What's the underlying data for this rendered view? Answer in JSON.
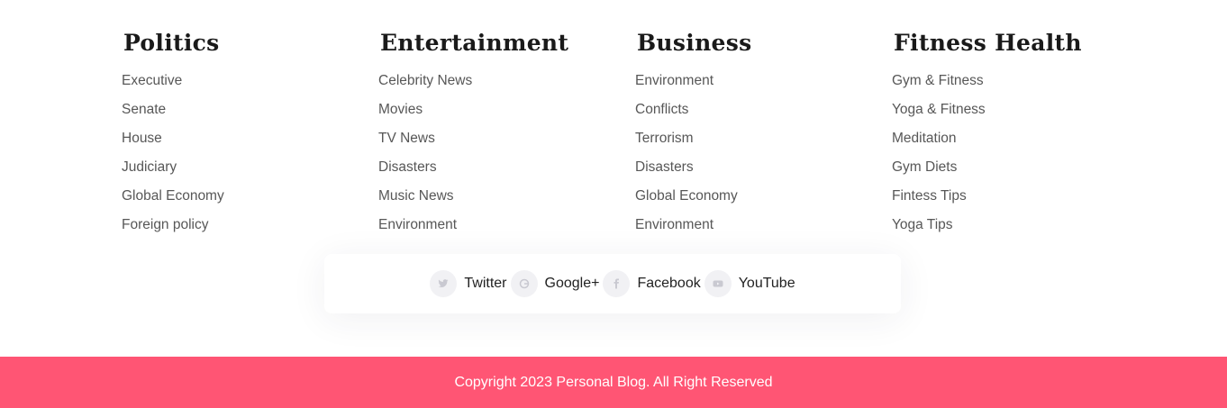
{
  "columns": [
    {
      "title": "Politics",
      "items": [
        "Executive",
        "Senate",
        "House",
        "Judiciary",
        "Global Economy",
        "Foreign policy"
      ]
    },
    {
      "title": "Entertainment",
      "items": [
        "Celebrity News",
        "Movies",
        "TV News",
        "Disasters",
        "Music News",
        "Environment"
      ]
    },
    {
      "title": "Business",
      "items": [
        "Environment",
        "Conflicts",
        "Terrorism",
        "Disasters",
        "Global Economy",
        "Environment"
      ]
    },
    {
      "title": "Fitness Health",
      "items": [
        "Gym & Fitness",
        "Yoga & Fitness",
        "Meditation",
        "Gym Diets",
        "Fintess Tips",
        "Yoga Tips"
      ]
    }
  ],
  "social": [
    {
      "label": "Twitter",
      "icon": "twitter-icon"
    },
    {
      "label": "Google+",
      "icon": "google-plus-icon"
    },
    {
      "label": "Facebook",
      "icon": "facebook-icon"
    },
    {
      "label": "YouTube",
      "icon": "youtube-icon"
    }
  ],
  "copyright": "Copyright 2023 Personal Blog. All Right Reserved",
  "colors": {
    "accent": "#ff5574",
    "icon_bg": "#f1f1f4",
    "icon_fg": "#c9c9d1"
  }
}
